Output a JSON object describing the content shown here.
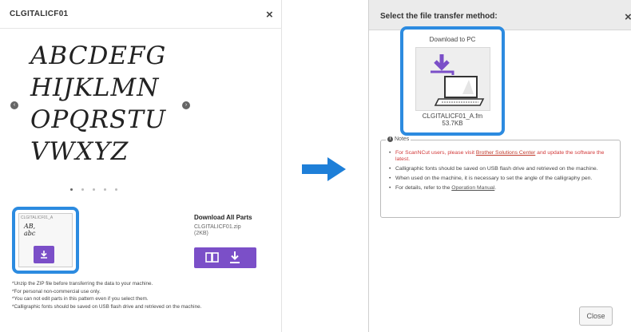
{
  "left_dialog": {
    "title": "CLGITALICF01",
    "close_glyph": "×",
    "glyph_lines": [
      "ABCDEFG",
      "HIJKLMN",
      "OPQRSTU",
      "VWXYZ"
    ],
    "prev_glyph": "‹",
    "next_glyph": "›",
    "part": {
      "label": "CLGITALICF01_A",
      "sample_line1": "AB,",
      "sample_line2": "abc",
      "download_icon": "download-icon"
    },
    "download_all": {
      "title": "Download All Parts",
      "file": "CLGITALICF01.zip",
      "size": "(2KB)",
      "button_icons": "book-icon download-icon"
    },
    "notes": [
      "*Unzip the ZIP file before transferring the data to your machine.",
      "*For personal non-commercial use only.",
      "*You can not edit parts in this pattern even if you select them.",
      "*Calligraphic fonts should be saved on USB flash drive and retrieved on the machine."
    ]
  },
  "right_dialog": {
    "title": "Select the file transfer method:",
    "close_glyph": "×",
    "download_label": "Download to PC",
    "file_name": "CLGITALICF01_A.fm",
    "file_size": "53.7KB",
    "notes_title": "Notes",
    "notes": {
      "n1_pre": "For ScanNCut users, please visit ",
      "n1_link": "Brother Solutions Center",
      "n1_post": " and update the software the latest.",
      "n2": "Calligraphic fonts should be saved on USB flash drive and retrieved on the machine.",
      "n3": "When used on the machine, it is necessary to set the angle of the calligraphy pen.",
      "n4_pre": "For details, refer to the ",
      "n4_link": "Operation Manual",
      "n4_post": "."
    },
    "close_button": "Close"
  },
  "colors": {
    "highlight_blue": "#2c8be0",
    "button_purple": "#7b4fc8",
    "arrow_blue": "#1e7fd8",
    "link_red": "#c0392b"
  }
}
